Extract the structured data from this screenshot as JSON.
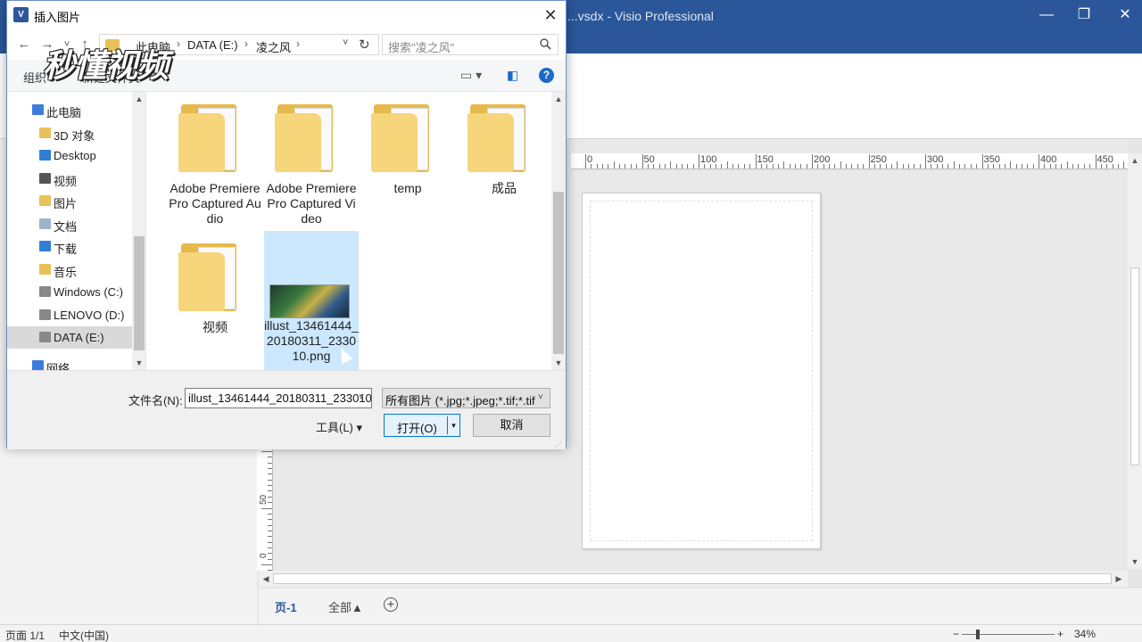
{
  "app": {
    "title": "...vsdx - Visio Professional",
    "min_glyph": "—",
    "restore_glyph": "❐",
    "close_glyph": "✕"
  },
  "ruler": {
    "h_labels": [
      "0",
      "50",
      "100",
      "150",
      "200",
      "250",
      "300",
      "350",
      "400",
      "450"
    ],
    "v_labels": [
      "50",
      "0"
    ]
  },
  "page_tabs": {
    "active": "页-1",
    "all": "全部▲",
    "add": "+"
  },
  "status": {
    "page": "页面 1/1",
    "lang": "中文(中国)",
    "zoom": "34%",
    "zoom_minus": "−",
    "zoom_plus": "+"
  },
  "dialog": {
    "title": "插入图片",
    "app_icon_letter": "V",
    "close_glyph": "✕",
    "nav": {
      "back": "←",
      "forward": "→",
      "recent": "˅",
      "up": "↑",
      "breadcrumbs": [
        "此电脑",
        "DATA (E:)",
        "凌之风"
      ],
      "sep": "›",
      "drop": "˅",
      "refresh": "↻"
    },
    "search_placeholder": "搜索\"凌之风\"",
    "toolbar": {
      "organize": "组织 ▾",
      "new_folder": "新建文件夹",
      "view_glyph": "▭ ▾",
      "pane_glyph": "◧",
      "help": "?"
    },
    "watermark": "秒懂视频",
    "nav_pane": [
      {
        "label": "此电脑",
        "color": "#3b7dd8",
        "indent": 0
      },
      {
        "label": "3D 对象",
        "color": "#e8c15a",
        "indent": 1
      },
      {
        "label": "Desktop",
        "color": "#2f7fd4",
        "indent": 1
      },
      {
        "label": "视频",
        "color": "#555555",
        "indent": 1
      },
      {
        "label": "图片",
        "color": "#e8c15a",
        "indent": 1
      },
      {
        "label": "文档",
        "color": "#9fb4cc",
        "indent": 1
      },
      {
        "label": "下载",
        "color": "#2f7fd4",
        "indent": 1
      },
      {
        "label": "音乐",
        "color": "#e8c15a",
        "indent": 1
      },
      {
        "label": "Windows (C:)",
        "color": "#888888",
        "indent": 1
      },
      {
        "label": "LENOVO (D:)",
        "color": "#888888",
        "indent": 1
      },
      {
        "label": "DATA (E:)",
        "color": "#888888",
        "indent": 1,
        "selected": true
      },
      {
        "label": "网络",
        "color": "#3b7dd8",
        "indent": 0
      }
    ],
    "files": [
      {
        "name": "Adobe Premiere Pro Captured Audio",
        "kind": "folder"
      },
      {
        "name": "Adobe Premiere Pro Captured Video",
        "kind": "folder"
      },
      {
        "name": "temp",
        "kind": "folder"
      },
      {
        "name": "成品",
        "kind": "folder"
      },
      {
        "name": "视频",
        "kind": "folder"
      },
      {
        "name": "illust_13461444_20180311_233010.png",
        "kind": "image",
        "selected": true
      }
    ],
    "filename_label": "文件名(N):",
    "filename_value": "illust_13461444_20180311_233010",
    "filetype_value": "所有图片 (*.jpg;*.jpeg;*.tif;*.tif",
    "tools_label": "工具(L)  ▾",
    "open_label": "打开(O)",
    "open_split": "▾",
    "cancel_label": "取消",
    "scroll_up": "▲",
    "scroll_down": "▼",
    "scroll_left": "◀",
    "scroll_right": "▶",
    "grip": "⋰"
  }
}
